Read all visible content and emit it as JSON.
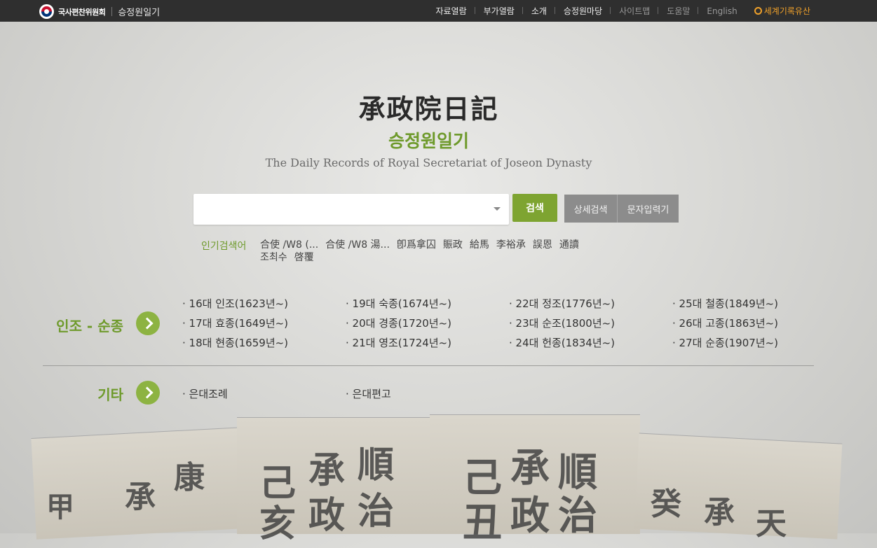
{
  "topbar": {
    "org": "국사편찬위원회",
    "site": "승정원일기",
    "nav": [
      "자료열람",
      "부가열람",
      "소개",
      "승정원마당"
    ],
    "util": [
      "사이트맵",
      "도움말",
      "English"
    ],
    "heritage": "세계기록유산"
  },
  "title": {
    "hanja": "承政院日記",
    "korean": "승정원일기",
    "english": "The Daily Records of Royal Secretariat of Joseon Dynasty"
  },
  "search": {
    "value": "",
    "placeholder": "",
    "button": "검색",
    "advanced": "상세검색",
    "char_input": "문자입력기"
  },
  "popular": {
    "label": "인기검색어",
    "items": [
      "合使 /W8 (...",
      "合使 /W8 湯...",
      "卽爲拿囚",
      "賑政",
      "給馬",
      "李裕承",
      "誤恩",
      "通讀",
      "조최수",
      "啓覆"
    ]
  },
  "reigns": {
    "label": "인조 - 순종",
    "items": [
      "· 16대 인조(1623년~)",
      "· 17대 효종(1649년~)",
      "· 18대 현종(1659년~)",
      "· 19대 숙종(1674년~)",
      "· 20대 경종(1720년~)",
      "· 21대 영조(1724년~)",
      "· 22대 정조(1776년~)",
      "· 23대 순조(1800년~)",
      "· 24대 헌종(1834년~)",
      "· 25대 철종(1849년~)",
      "· 26대 고종(1863년~)",
      "· 27대 순종(1907년~)"
    ]
  },
  "other": {
    "label": "기타",
    "items": [
      "· 은대조례",
      "· 은대편고"
    ]
  },
  "books_glyphs": [
    "甲",
    "承",
    "康",
    "己",
    "承",
    "順",
    "亥",
    "政",
    "治",
    "己",
    "承",
    "順",
    "丑",
    "政",
    "治",
    "癸",
    "承",
    "天"
  ]
}
